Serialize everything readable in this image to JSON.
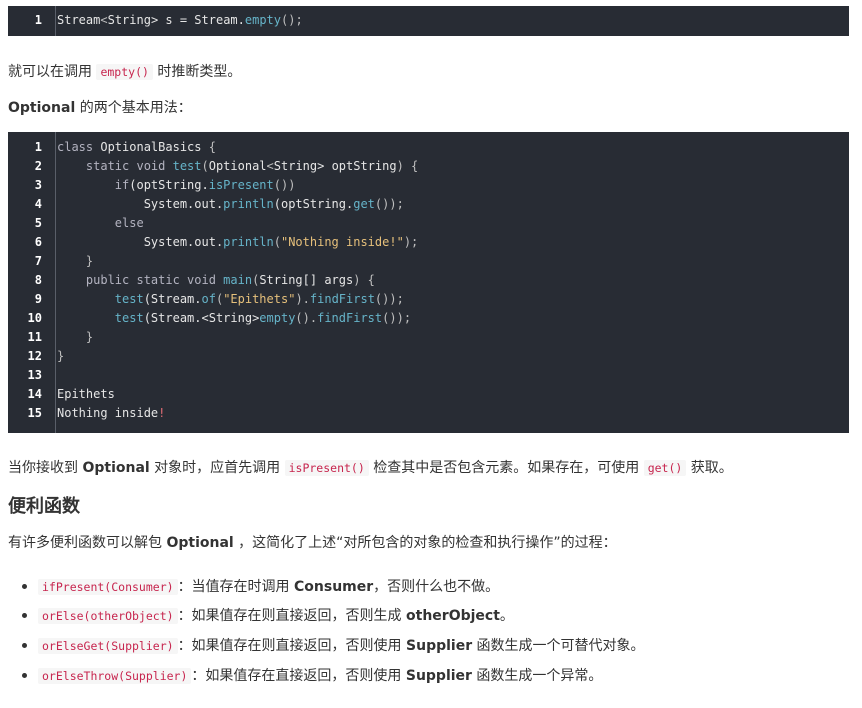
{
  "block1": {
    "lines": [
      {
        "num": "1",
        "tokens": [
          {
            "t": "Stream",
            "c": ""
          },
          {
            "t": "<",
            "c": "punc"
          },
          {
            "t": "String",
            "c": ""
          },
          {
            "t": "> s = Stream.",
            "c": ""
          },
          {
            "t": "empty",
            "c": "fn"
          },
          {
            "t": "();",
            "c": "punc"
          }
        ]
      }
    ]
  },
  "para1": {
    "text_before": "就可以在调用 ",
    "code": "empty()",
    "text_after": " 时推断类型。"
  },
  "para2": {
    "bold": "Optional",
    "text": " 的两个基本用法："
  },
  "block2": {
    "lines": [
      {
        "num": "1",
        "tokens": [
          {
            "t": "class ",
            "c": "kw"
          },
          {
            "t": "OptionalBasics",
            "c": ""
          },
          {
            "t": " {",
            "c": "punc"
          }
        ]
      },
      {
        "num": "2",
        "tokens": [
          {
            "t": "    static void ",
            "c": "kw"
          },
          {
            "t": "test",
            "c": "fn"
          },
          {
            "t": "(",
            "c": "punc"
          },
          {
            "t": "Optional",
            "c": ""
          },
          {
            "t": "<",
            "c": "punc"
          },
          {
            "t": "String",
            "c": ""
          },
          {
            "t": "> optString",
            "c": ""
          },
          {
            "t": ") {",
            "c": "punc"
          }
        ]
      },
      {
        "num": "3",
        "tokens": [
          {
            "t": "        if",
            "c": "kw"
          },
          {
            "t": "(optString.",
            "c": ""
          },
          {
            "t": "isPresent",
            "c": "fn"
          },
          {
            "t": "())",
            "c": "punc"
          }
        ]
      },
      {
        "num": "4",
        "tokens": [
          {
            "t": "            System.out.",
            "c": ""
          },
          {
            "t": "println",
            "c": "fn"
          },
          {
            "t": "(optString.",
            "c": ""
          },
          {
            "t": "get",
            "c": "fn"
          },
          {
            "t": "());",
            "c": "punc"
          }
        ]
      },
      {
        "num": "5",
        "tokens": [
          {
            "t": "        else",
            "c": "kw"
          }
        ]
      },
      {
        "num": "6",
        "tokens": [
          {
            "t": "            System.out.",
            "c": ""
          },
          {
            "t": "println",
            "c": "fn"
          },
          {
            "t": "(",
            "c": "punc"
          },
          {
            "t": "\"Nothing inside!\"",
            "c": "str"
          },
          {
            "t": ");",
            "c": "punc"
          }
        ]
      },
      {
        "num": "7",
        "tokens": [
          {
            "t": "    }",
            "c": "punc"
          }
        ]
      },
      {
        "num": "8",
        "tokens": [
          {
            "t": "    public static void ",
            "c": "kw"
          },
          {
            "t": "main",
            "c": "fn"
          },
          {
            "t": "(",
            "c": "punc"
          },
          {
            "t": "String[] args",
            "c": ""
          },
          {
            "t": ") {",
            "c": "punc"
          }
        ]
      },
      {
        "num": "9",
        "tokens": [
          {
            "t": "        ",
            "c": ""
          },
          {
            "t": "test",
            "c": "fn"
          },
          {
            "t": "(Stream.",
            "c": ""
          },
          {
            "t": "of",
            "c": "fn"
          },
          {
            "t": "(",
            "c": "punc"
          },
          {
            "t": "\"Epithets\"",
            "c": "str"
          },
          {
            "t": ").",
            "c": "punc"
          },
          {
            "t": "findFirst",
            "c": "fn"
          },
          {
            "t": "());",
            "c": "punc"
          }
        ]
      },
      {
        "num": "10",
        "tokens": [
          {
            "t": "        ",
            "c": ""
          },
          {
            "t": "test",
            "c": "fn"
          },
          {
            "t": "(Stream.<String>",
            "c": ""
          },
          {
            "t": "empty",
            "c": "fn"
          },
          {
            "t": "().",
            "c": "punc"
          },
          {
            "t": "findFirst",
            "c": "fn"
          },
          {
            "t": "());",
            "c": "punc"
          }
        ]
      },
      {
        "num": "11",
        "tokens": [
          {
            "t": "    }",
            "c": "punc"
          }
        ]
      },
      {
        "num": "12",
        "tokens": [
          {
            "t": "}",
            "c": "punc"
          }
        ]
      },
      {
        "num": "13",
        "tokens": []
      },
      {
        "num": "14",
        "tokens": [
          {
            "t": "Epithets",
            "c": ""
          }
        ]
      },
      {
        "num": "15",
        "tokens": [
          {
            "t": "Nothing inside",
            "c": ""
          },
          {
            "t": "!",
            "c": "warn"
          }
        ]
      }
    ]
  },
  "para3": {
    "t1": "当你接收到 ",
    "b1": "Optional",
    "t2": " 对象时，应首先调用 ",
    "c1": "isPresent()",
    "t3": " 检查其中是否包含元素。如果存在，可使用 ",
    "c2": "get()",
    "t4": " 获取。"
  },
  "heading": "便利函数",
  "para4": {
    "t1": "有许多便利函数可以解包 ",
    "b1": "Optional",
    "t2": " ，这简化了上述“对所包含的对象的检查和执行操作”的过程："
  },
  "bullets": [
    {
      "code": "ifPresent(Consumer)",
      "t1": "：当值存在时调用 ",
      "b": "Consumer",
      "t2": "，否则什么也不做。"
    },
    {
      "code": "orElse(otherObject)",
      "t1": "：如果值存在则直接返回，否则生成 ",
      "b": "otherObject",
      "t2": "。"
    },
    {
      "code": "orElseGet(Supplier)",
      "t1": "：如果值存在则直接返回，否则使用 ",
      "b": "Supplier",
      "t2": " 函数生成一个可替代对象。"
    },
    {
      "code": "orElseThrow(Supplier)",
      "t1": "：如果值存在直接返回，否则使用 ",
      "b": "Supplier",
      "t2": " 函数生成一个异常。"
    }
  ]
}
